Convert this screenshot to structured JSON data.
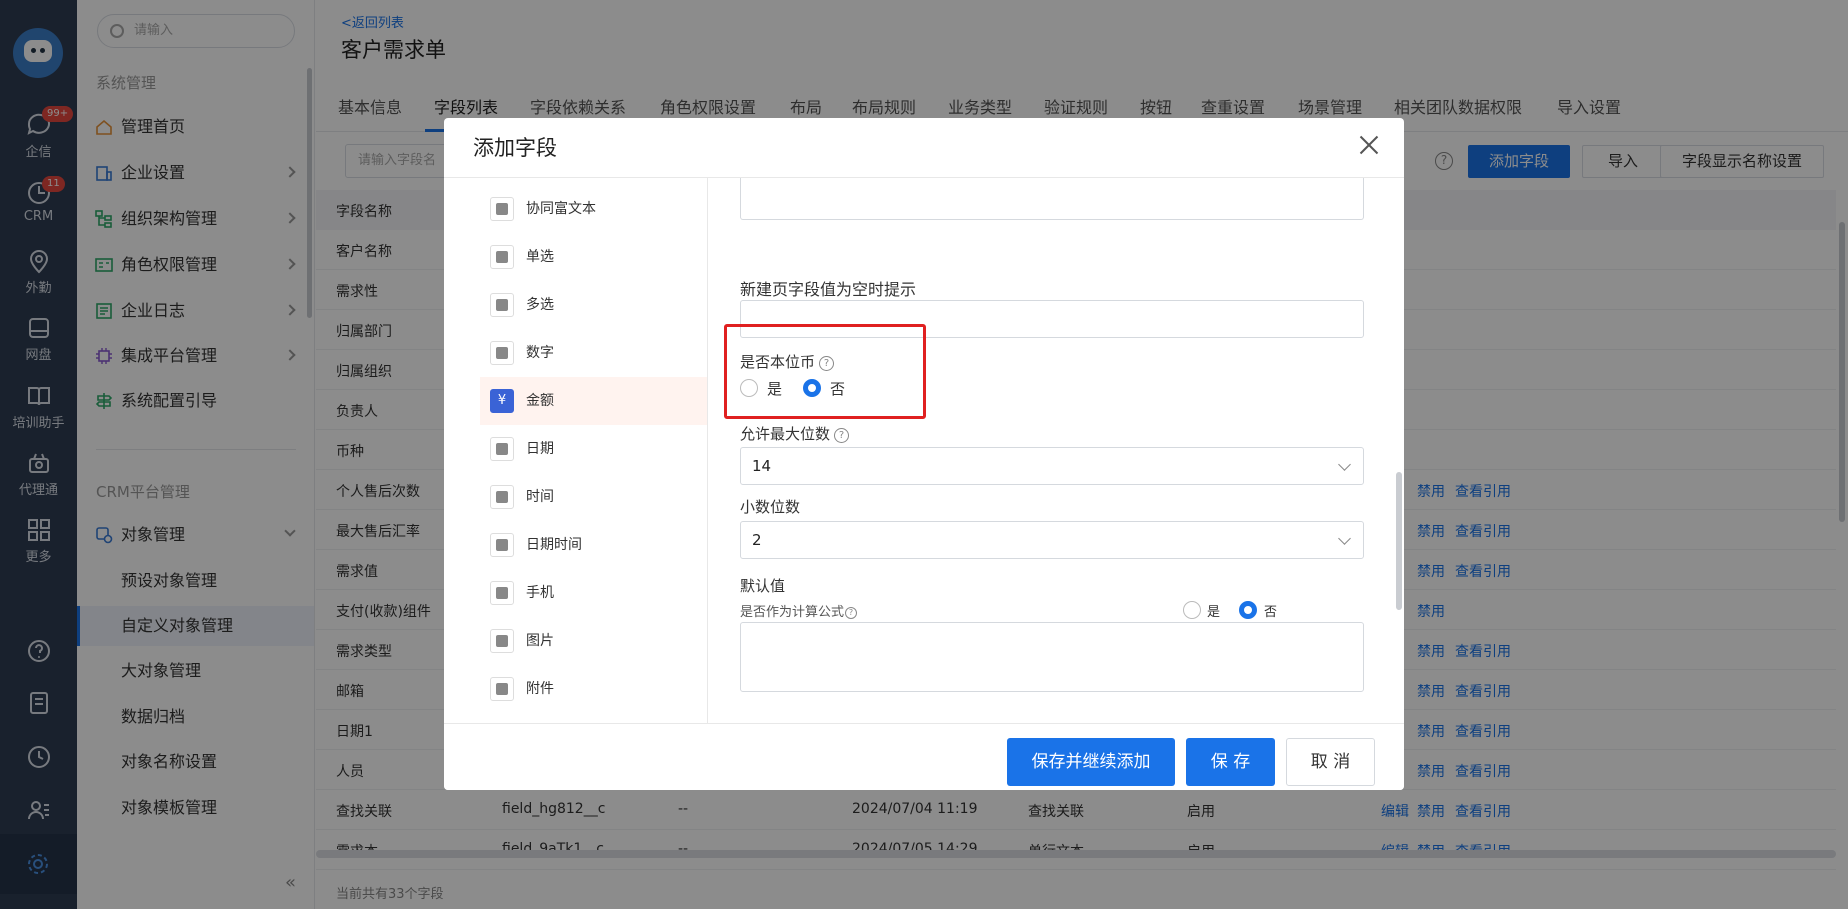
{
  "rail": {
    "items": [
      {
        "label": "企信",
        "badge": "99+"
      },
      {
        "label": "CRM",
        "badge": "11"
      },
      {
        "label": "外勤"
      },
      {
        "label": "网盘"
      },
      {
        "label": "培训助手"
      },
      {
        "label": "代理通"
      },
      {
        "label": "更多"
      }
    ]
  },
  "sidebar": {
    "search_placeholder": "请输入",
    "section1": "系统管理",
    "items": [
      "管理首页",
      "企业设置",
      "组织架构管理",
      "角色权限管理",
      "企业日志",
      "集成平台管理",
      "系统配置引导"
    ],
    "section2": "CRM平台管理",
    "object_mgmt": "对象管理",
    "subitems": [
      "预设对象管理",
      "自定义对象管理",
      "大对象管理",
      "数据归档",
      "对象名称设置",
      "对象模板管理"
    ],
    "collapse": "«"
  },
  "page": {
    "back": "<返回列表",
    "title": "客户需求单",
    "tabs": [
      "基本信息",
      "字段列表",
      "字段依赖关系",
      "角色权限设置",
      "布局",
      "布局规则",
      "业务类型",
      "验证规则",
      "按钮",
      "查重设置",
      "场景管理",
      "相关团队数据权限",
      "导入设置"
    ],
    "field_search_placeholder": "请输入字段名",
    "btn_add": "添加字段",
    "btn_import": "导入",
    "btn_display": "字段显示名称设置",
    "col_field_name": "字段名称",
    "rows": [
      {
        "name": "客户名称",
        "api": "",
        "desc": "",
        "time": "",
        "type": "",
        "status": "",
        "actions": []
      },
      {
        "name": "需求性",
        "api": "",
        "desc": "",
        "time": "",
        "type": "",
        "status": "",
        "actions": []
      },
      {
        "name": "归属部门",
        "api": "",
        "desc": "",
        "time": "",
        "type": "",
        "status": "",
        "actions": []
      },
      {
        "name": "归属组织",
        "api": "",
        "desc": "",
        "time": "",
        "type": "",
        "status": "",
        "actions": []
      },
      {
        "name": "负责人",
        "api": "",
        "desc": "",
        "time": "",
        "type": "",
        "status": "",
        "actions": []
      },
      {
        "name": "币种",
        "api": "",
        "desc": "",
        "time": "",
        "type": "",
        "status": "",
        "actions": []
      },
      {
        "name": "个人售后次数",
        "api": "",
        "desc": "",
        "time": "",
        "type": "",
        "status": "",
        "actions": [
          "禁用",
          "查看引用"
        ]
      },
      {
        "name": "最大售后汇率",
        "api": "",
        "desc": "",
        "time": "",
        "type": "",
        "status": "",
        "actions": [
          "禁用",
          "查看引用"
        ]
      },
      {
        "name": "需求值",
        "api": "",
        "desc": "",
        "time": "",
        "type": "",
        "status": "",
        "actions": [
          "禁用",
          "查看引用"
        ]
      },
      {
        "name": "支付(收款)组件",
        "api": "",
        "desc": "",
        "time": "",
        "type": "",
        "status": "",
        "actions": [
          "禁用"
        ]
      },
      {
        "name": "需求类型",
        "api": "",
        "desc": "",
        "time": "",
        "type": "",
        "status": "",
        "actions": [
          "禁用",
          "查看引用"
        ]
      },
      {
        "name": "邮箱",
        "api": "",
        "desc": "",
        "time": "",
        "type": "",
        "status": "",
        "actions": [
          "禁用",
          "查看引用"
        ]
      },
      {
        "name": "日期1",
        "api": "",
        "desc": "",
        "time": "",
        "type": "",
        "status": "",
        "actions": [
          "禁用",
          "查看引用"
        ]
      },
      {
        "name": "人员",
        "api": "",
        "desc": "",
        "time": "",
        "type": "",
        "status": "",
        "actions": [
          "禁用",
          "查看引用"
        ]
      },
      {
        "name": "查找关联",
        "api": "field_hg812__c",
        "desc": "--",
        "time": "2024/07/04 11:19",
        "type": "查找关联",
        "status": "启用",
        "actions": [
          "编辑",
          "禁用",
          "查看引用"
        ]
      },
      {
        "name": "需求本",
        "api": "field_9aTk1__c",
        "desc": "--",
        "time": "2024/07/05 14:29",
        "type": "单行文本",
        "status": "启用",
        "actions": [
          "编辑",
          "禁用",
          "查看引用"
        ]
      }
    ],
    "footer": "当前共有33个字段"
  },
  "modal": {
    "title": "添加字段",
    "field_types": [
      "协同富文本",
      "单选",
      "多选",
      "数字",
      "金额",
      "日期",
      "时间",
      "日期时间",
      "手机",
      "图片",
      "附件"
    ],
    "active_type": "金额",
    "active_type_glyph": "¥",
    "empty_hint_label": "新建页字段值为空时提示",
    "local_currency_label": "是否本位币",
    "yes": "是",
    "no": "否",
    "max_digits_label": "允许最大位数",
    "max_digits_value": "14",
    "decimal_label": "小数位数",
    "decimal_value": "2",
    "default_label": "默认值",
    "formula_label": "是否作为计算公式",
    "btn_save_continue": "保存并继续添加",
    "btn_save": "保 存",
    "btn_cancel": "取 消"
  }
}
